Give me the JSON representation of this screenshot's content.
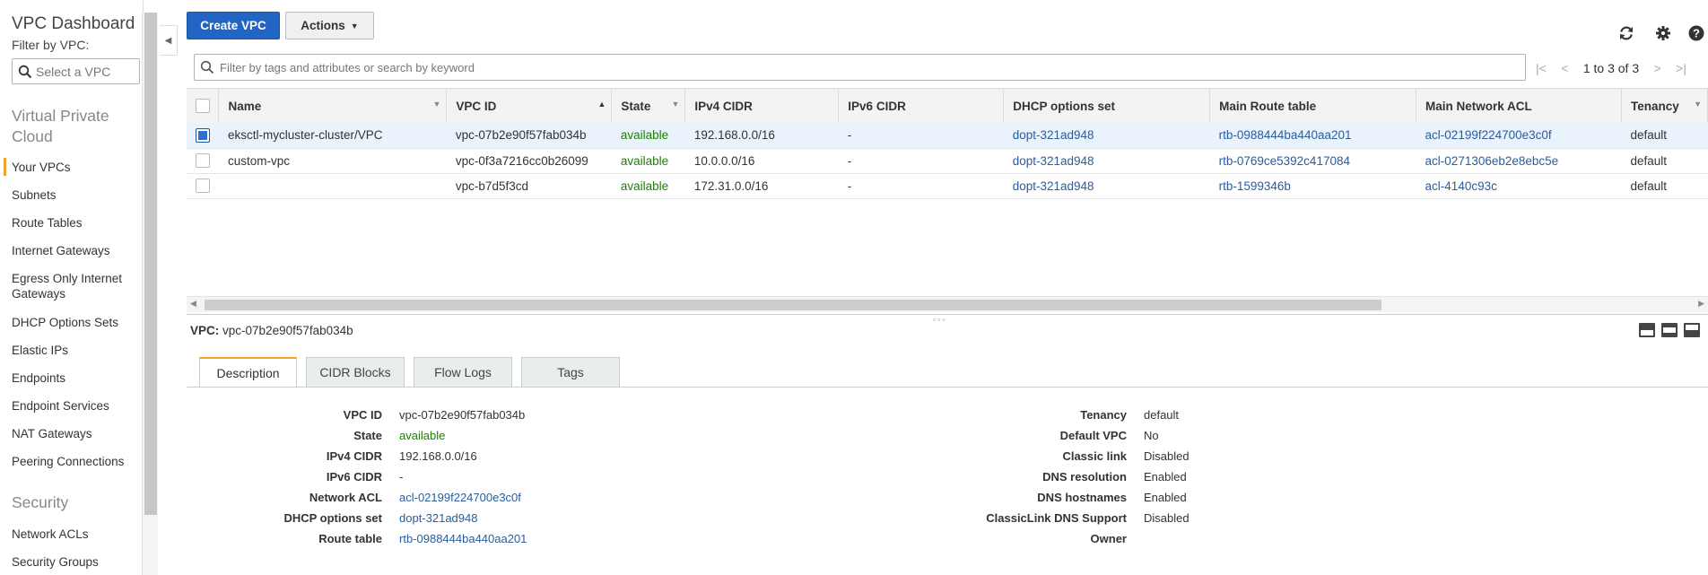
{
  "sidebar": {
    "title": "VPC Dashboard",
    "filter_label": "Filter by VPC:",
    "filter_placeholder": "Select a VPC",
    "section_vpc": "Virtual Private Cloud",
    "items": [
      {
        "label": "Your VPCs"
      },
      {
        "label": "Subnets"
      },
      {
        "label": "Route Tables"
      },
      {
        "label": "Internet Gateways"
      },
      {
        "label": "Egress Only Internet Gateways"
      },
      {
        "label": "DHCP Options Sets"
      },
      {
        "label": "Elastic IPs"
      },
      {
        "label": "Endpoints"
      },
      {
        "label": "Endpoint Services"
      },
      {
        "label": "NAT Gateways"
      },
      {
        "label": "Peering Connections"
      }
    ],
    "section_security": "Security",
    "security_items": [
      {
        "label": "Network ACLs"
      },
      {
        "label": "Security Groups"
      }
    ]
  },
  "toolbar": {
    "create_label": "Create VPC",
    "actions_label": "Actions",
    "icons": [
      "refresh-icon",
      "gear-icon",
      "help-icon"
    ]
  },
  "search": {
    "placeholder": "Filter by tags and attributes or search by keyword"
  },
  "pager": {
    "text": "1 to 3 of 3"
  },
  "table": {
    "columns": [
      "Name",
      "VPC ID",
      "State",
      "IPv4 CIDR",
      "IPv6 CIDR",
      "DHCP options set",
      "Main Route table",
      "Main Network ACL",
      "Tenancy"
    ],
    "rows": [
      {
        "selected": true,
        "name": "eksctl-mycluster-cluster/VPC",
        "vpc_id": "vpc-07b2e90f57fab034b",
        "state": "available",
        "ipv4": "192.168.0.0/16",
        "ipv6": "-",
        "dhcp": "dopt-321ad948",
        "route": "rtb-0988444ba440aa201",
        "acl": "acl-02199f224700e3c0f",
        "tenancy": "default"
      },
      {
        "selected": false,
        "name": "custom-vpc",
        "vpc_id": "vpc-0f3a7216cc0b26099",
        "state": "available",
        "ipv4": "10.0.0.0/16",
        "ipv6": "-",
        "dhcp": "dopt-321ad948",
        "route": "rtb-0769ce5392c417084",
        "acl": "acl-0271306eb2e8ebc5e",
        "tenancy": "default"
      },
      {
        "selected": false,
        "name": "",
        "vpc_id": "vpc-b7d5f3cd",
        "state": "available",
        "ipv4": "172.31.0.0/16",
        "ipv6": "-",
        "dhcp": "dopt-321ad948",
        "route": "rtb-1599346b",
        "acl": "acl-4140c93c",
        "tenancy": "default"
      }
    ]
  },
  "detail": {
    "header_label": "VPC:",
    "header_value": "vpc-07b2e90f57fab034b",
    "tabs": [
      {
        "label": "Description",
        "active": true
      },
      {
        "label": "CIDR Blocks",
        "active": false
      },
      {
        "label": "Flow Logs",
        "active": false
      },
      {
        "label": "Tags",
        "active": false
      }
    ],
    "left": [
      {
        "k": "VPC ID",
        "v": "vpc-07b2e90f57fab034b",
        "style": ""
      },
      {
        "k": "State",
        "v": "available",
        "style": "avail"
      },
      {
        "k": "IPv4 CIDR",
        "v": "192.168.0.0/16",
        "style": ""
      },
      {
        "k": "IPv6 CIDR",
        "v": "-",
        "style": ""
      },
      {
        "k": "Network ACL",
        "v": "acl-02199f224700e3c0f",
        "style": "lnk"
      },
      {
        "k": "DHCP options set",
        "v": "dopt-321ad948",
        "style": "lnk"
      },
      {
        "k": "Route table",
        "v": "rtb-0988444ba440aa201",
        "style": "lnk"
      }
    ],
    "right": [
      {
        "k": "Tenancy",
        "v": "default",
        "style": ""
      },
      {
        "k": "Default VPC",
        "v": "No",
        "style": ""
      },
      {
        "k": "Classic link",
        "v": "Disabled",
        "style": ""
      },
      {
        "k": "DNS resolution",
        "v": "Enabled",
        "style": ""
      },
      {
        "k": "DNS hostnames",
        "v": "Enabled",
        "style": ""
      },
      {
        "k": "ClassicLink DNS Support",
        "v": "Disabled",
        "style": ""
      },
      {
        "k": "Owner",
        "v": "",
        "style": ""
      }
    ]
  },
  "colors": {
    "primary": "#2265c4",
    "available": "#1d8102",
    "link": "#2a5d9c",
    "accent": "#f0a42b"
  }
}
